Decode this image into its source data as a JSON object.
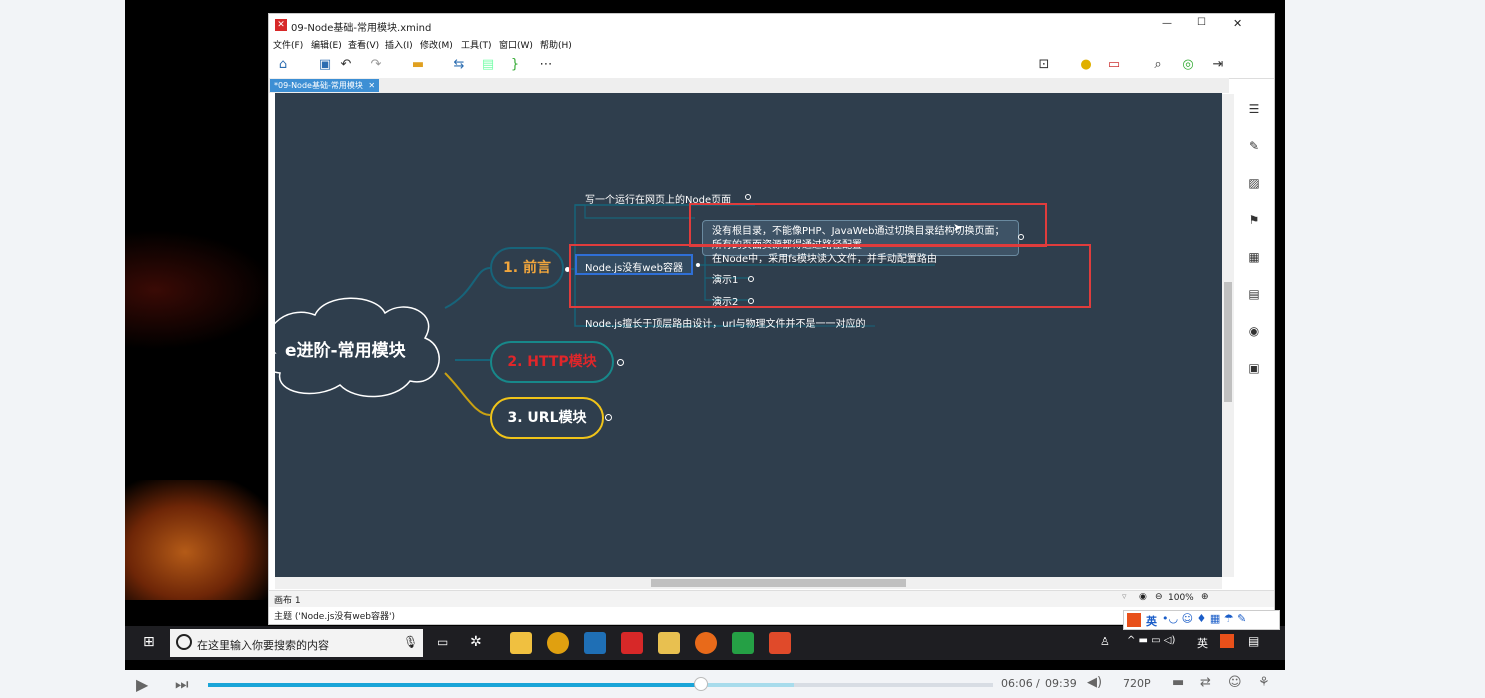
{
  "window": {
    "title": "09-Node基础-常用模块.xmind",
    "controls": {
      "minimize": "—",
      "maximize": "☐",
      "close": "✕"
    }
  },
  "menu": [
    "文件(F)",
    "编辑(E)",
    "查看(V)",
    "插入(I)",
    "修改(M)",
    "工具(T)",
    "窗口(W)",
    "帮助(H)"
  ],
  "tab": {
    "label": "*09-Node基础-常用模块",
    "close": "✕"
  },
  "mindmap": {
    "central": "e进阶-常用模块",
    "branch1": {
      "label": "1. 前言",
      "topic_top": "写一个运行在网页上的Node页面",
      "selected": "Node.js没有web容器",
      "note": "没有根目录，不能像PHP、JavaWeb通过切换目录结构切换页面；所有的页面资源都得通过路径配置",
      "sub1": "在Node中，采用fs模块读入文件，并手动配置路由",
      "sub2": "演示1",
      "sub3": "演示2",
      "topic_bottom": "Node.js擅长于顶层路由设计，url与物理文件并不是一一对应的"
    },
    "branch2": {
      "label": "2. HTTP模块"
    },
    "branch3": {
      "label": "3. URL模块"
    }
  },
  "status": {
    "sheet": "画布 1",
    "topic": "主题 ('Node.js没有web容器')",
    "zoom": "100%"
  },
  "taskbar": {
    "search_placeholder": "在这里输入你要搜索的内容"
  },
  "tray": {
    "ime": "英"
  },
  "player": {
    "current": "06:06",
    "separator": "/",
    "total": "09:39",
    "quality": "720P",
    "progress": 0.628,
    "buffered": 0.746
  },
  "colors": {
    "canvas": "#2f3e4d",
    "accent": "#3d8fd4",
    "branch1": "#f0a53c",
    "branch2": "#e0262a",
    "branch3": "#f0c419"
  }
}
